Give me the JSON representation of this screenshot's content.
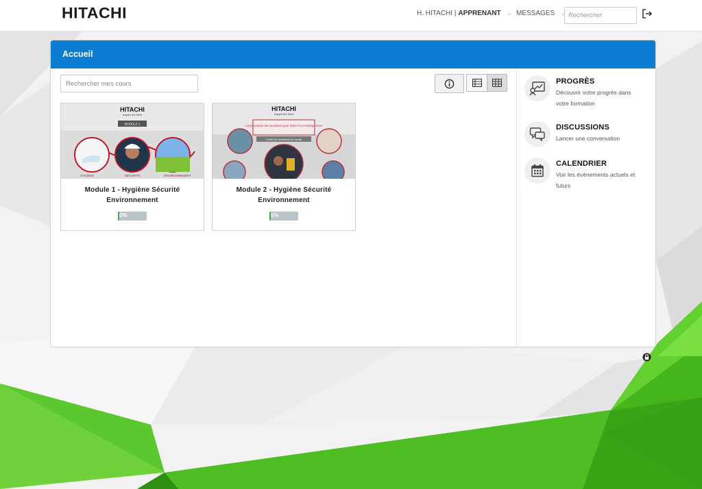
{
  "header": {
    "logo": "HITACHI",
    "user_name": "H. HITACHI |",
    "user_role": "APPRENANT",
    "messages_label": "MESSAGES",
    "search_placeholder": "Rechercher",
    "logout_icon": "logout-icon"
  },
  "main": {
    "title": "Accueil",
    "course_search_placeholder": "Rechercher mes cours",
    "toolbar": {
      "info_icon": "info-icon",
      "list_view_icon": "list-view-icon",
      "grid_view_icon": "grid-view-icon",
      "active_view": "grid"
    },
    "courses": [
      {
        "title": "Module 1 - Hygiène Sécurité Environnement",
        "progress_label": "0%",
        "progress": 0,
        "thumb": {
          "brand": "HITACHI",
          "tagline": "Inspire the Next",
          "badge": "MODULE 1",
          "captions": [
            "HYGIENE",
            "SECURITE",
            "ENVIRONNEMENT"
          ]
        }
      },
      {
        "title": "Module 2 - Hygiène Sécurité Environnement",
        "progress_label": "0%",
        "progress": 0,
        "thumb": {
          "brand": "HITACHI",
          "tagline": "Inspire the Next",
          "headline": "La prévention des accidents pour limiter les conséquences",
          "badge": "Eviter les accidents de travail"
        }
      }
    ]
  },
  "sidebar": {
    "items": [
      {
        "title": "PROGRÈS",
        "desc": "Découvrir votre progrès dans votre formation",
        "icon": "progress-chart-icon"
      },
      {
        "title": "DISCUSSIONS",
        "desc": "Lancer une conversation",
        "icon": "chat-bubbles-icon"
      },
      {
        "title": "CALENDRIER",
        "desc": "Voir les événements actuels et futurs",
        "icon": "calendar-icon"
      }
    ]
  },
  "colors": {
    "header_blue": "#0d7dd3",
    "green": "#5cc82f",
    "progress_fill": "#2fb44a"
  }
}
